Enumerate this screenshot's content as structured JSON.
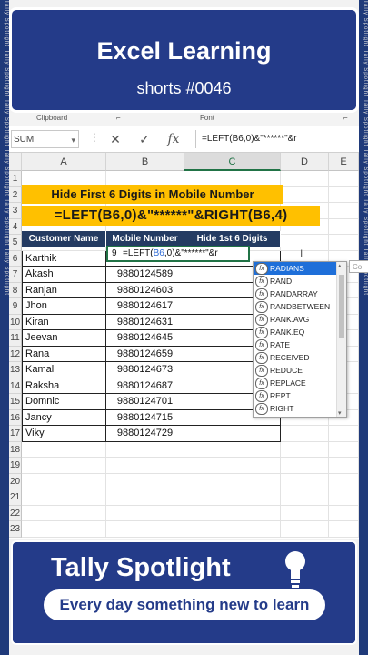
{
  "header": {
    "title": "Excel Learning",
    "subtitle": "shorts #0046"
  },
  "ribbon": {
    "group1": "Clipboard",
    "group2": "Font"
  },
  "formula_bar": {
    "name_box": "SUM",
    "cancel": "✕",
    "enter": "✓",
    "fx": "fx",
    "content": "=LEFT(B6,0)&\"******\"&r"
  },
  "columns": [
    "A",
    "B",
    "C",
    "D",
    "E"
  ],
  "rows": [
    "1",
    "2",
    "3",
    "4",
    "5",
    "6",
    "7",
    "8",
    "9",
    "10",
    "11",
    "12",
    "13",
    "14",
    "15",
    "16",
    "17",
    "18",
    "19",
    "20",
    "21",
    "22",
    "23"
  ],
  "banner_title": "Hide First 6 Digits in Mobile Number",
  "banner_formula": "=LEFT(B6,0)&\"******\"&RIGHT(B6,4)",
  "table": {
    "headers": [
      "Customer Name",
      "Mobile Number",
      "Hide 1st 6 Digits"
    ],
    "editing_prefix": "9",
    "editing_formula_a": "=LEFT(",
    "editing_formula_ref": "B6",
    "editing_formula_b": ",0)&\"******\"&r",
    "rows": [
      {
        "name": "Karthik",
        "mobile": ""
      },
      {
        "name": "Akash",
        "mobile": "9880124589"
      },
      {
        "name": "Ranjan",
        "mobile": "9880124603"
      },
      {
        "name": "Jhon",
        "mobile": "9880124617"
      },
      {
        "name": "Kiran",
        "mobile": "9880124631"
      },
      {
        "name": "Jeevan",
        "mobile": "9880124645"
      },
      {
        "name": "Rana",
        "mobile": "9880124659"
      },
      {
        "name": "Kamal",
        "mobile": "9880124673"
      },
      {
        "name": "Raksha",
        "mobile": "9880124687"
      },
      {
        "name": "Domnic",
        "mobile": "9880124701"
      },
      {
        "name": "Jancy",
        "mobile": "9880124715"
      },
      {
        "name": "Viky",
        "mobile": "9880124729"
      }
    ]
  },
  "autocomplete": {
    "selected": "RADIANS",
    "items": [
      "RADIANS",
      "RAND",
      "RANDARRAY",
      "RANDBETWEEN",
      "RANK.AVG",
      "RANK.EQ",
      "RATE",
      "RECEIVED",
      "REDUCE",
      "REPLACE",
      "REPT",
      "RIGHT"
    ],
    "icon": "fx"
  },
  "comment_stub": "Co",
  "footer": {
    "title": "Tally Spotlight",
    "tagline": "Every day something new to learn"
  },
  "watermark": "Tally Spotlight Tally Spotlight Tally Spotlight Tally Spotlight Tally Spotlight Tally Spotlight",
  "colors": {
    "brand_blue": "#243b89",
    "highlight": "#ffc000",
    "table_header": "#243b62",
    "selection": "#1e6fd9",
    "excel_green": "#217346"
  }
}
